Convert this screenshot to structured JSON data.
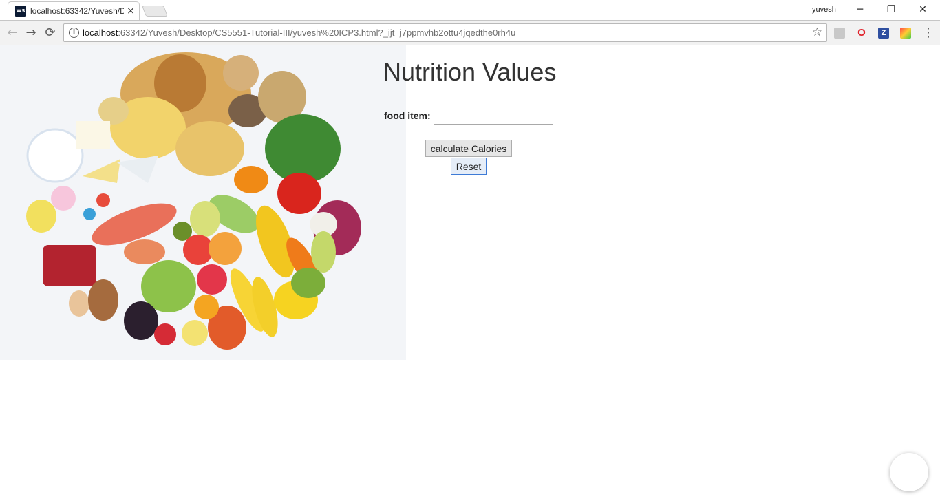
{
  "browser": {
    "tab_title": "localhost:63342/Yuvesh/D",
    "favicon_text": "WS",
    "close_glyph": "×",
    "username": "yuvesh",
    "url_host": "localhost",
    "url_rest": ":63342/Yuvesh/Desktop/CS5551-Tutorial-III/yuvesh%20ICP3.html?_ijt=j7ppmvhb2ottu4jqedthe0rh4u",
    "back_icon": "←",
    "forward_icon": "→",
    "reload_icon": "⟳",
    "info_icon": "i",
    "star_icon": "☆",
    "menu_icon": "⋮",
    "minimize_icon": "─",
    "restore_icon": "❐",
    "window_close_icon": "✕",
    "extensions": [
      {
        "name": "pdf-extension-icon",
        "glyph": "",
        "color": "#b0b0b0"
      },
      {
        "name": "opera-extension-icon",
        "glyph": "O",
        "color": "#e0212a"
      },
      {
        "name": "z-extension-icon",
        "glyph": "Z",
        "color": "#2f4fa0"
      },
      {
        "name": "colorful-extension-icon",
        "glyph": "",
        "color": "#f39c12"
      }
    ]
  },
  "page": {
    "title": "Nutrition Values",
    "food_label": "food item:",
    "food_value": "",
    "calculate_button": "calculate Calories",
    "reset_button": "Reset"
  }
}
